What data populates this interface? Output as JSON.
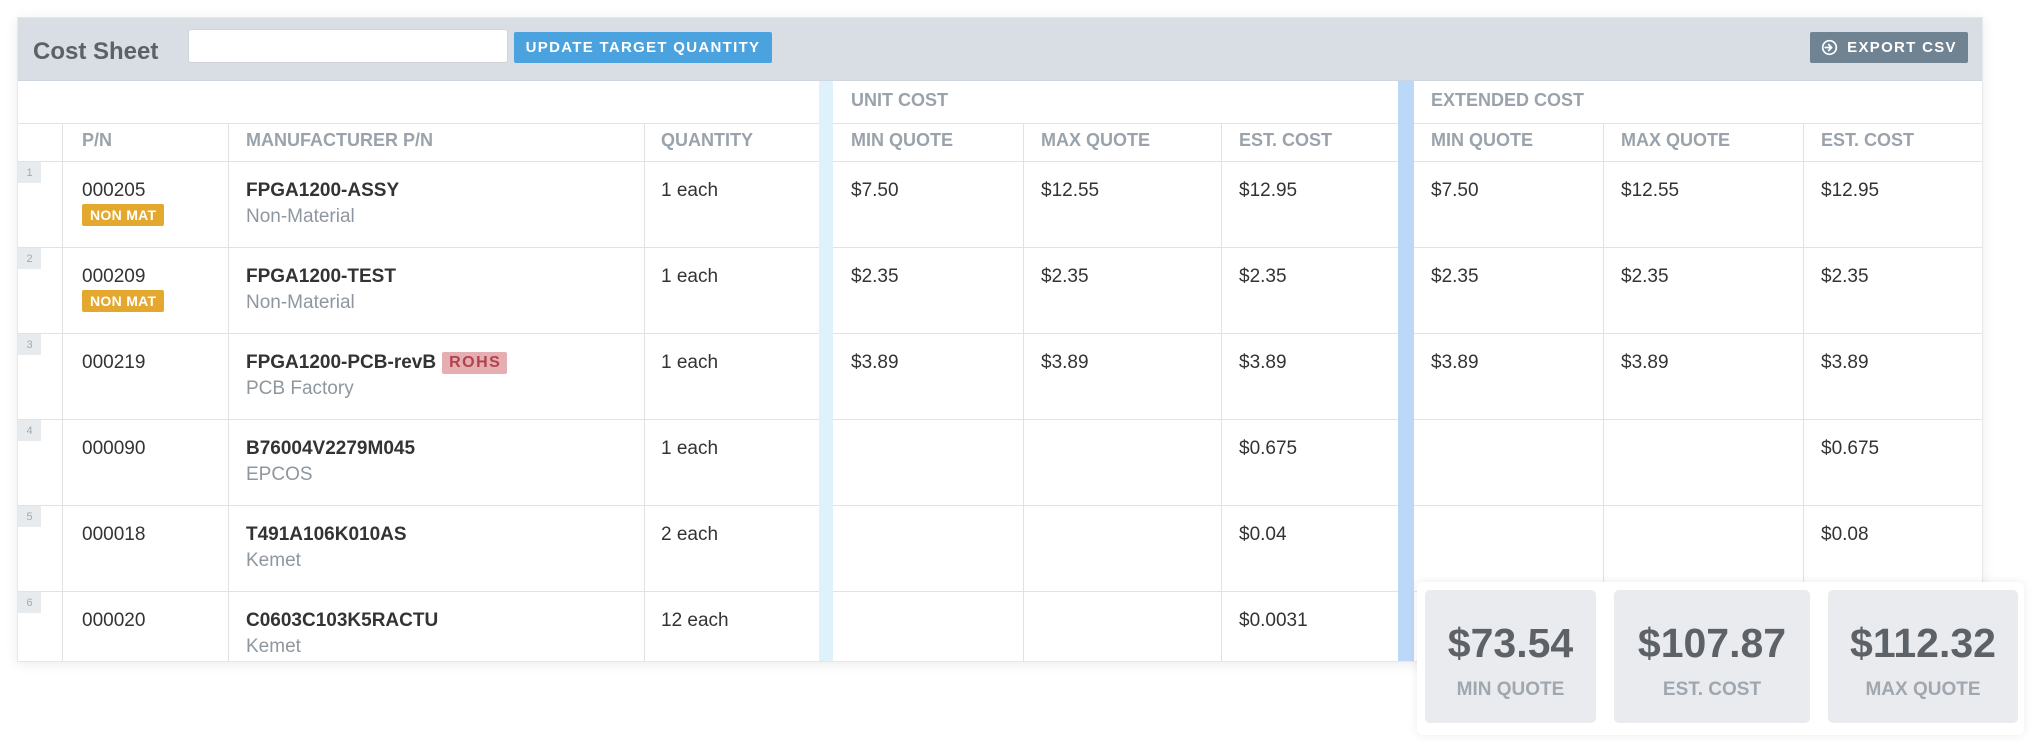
{
  "toolbar": {
    "title": "Cost Sheet",
    "quantity_input_value": "",
    "quantity_input_placeholder": "",
    "update_button_label": "UPDATE TARGET QUANTITY",
    "export_button_label": "EXPORT CSV",
    "update_button_color": "#4aa3df",
    "export_button_color": "#6f8392"
  },
  "groups": {
    "unit_cost": "UNIT COST",
    "extended_cost": "EXTENDED COST"
  },
  "columns": {
    "pn": "P/N",
    "manufacturer_pn": "MANUFACTURER P/N",
    "quantity": "QUANTITY",
    "unit_min": "MIN QUOTE",
    "unit_max": "MAX QUOTE",
    "unit_est": "EST. COST",
    "ext_min": "MIN QUOTE",
    "ext_max": "MAX QUOTE",
    "ext_est": "EST. COST"
  },
  "rows": [
    {
      "num": "1",
      "pn": "000205",
      "badge": "NON MAT",
      "mpn": "FPGA1200-ASSY",
      "rohs": "",
      "mfr": "Non-Material",
      "qty": "1 each",
      "unit_min": "$7.50",
      "unit_max": "$12.55",
      "unit_est": "$12.95",
      "ext_min": "$7.50",
      "ext_max": "$12.55",
      "ext_est": "$12.95"
    },
    {
      "num": "2",
      "pn": "000209",
      "badge": "NON MAT",
      "mpn": "FPGA1200-TEST",
      "rohs": "",
      "mfr": "Non-Material",
      "qty": "1 each",
      "unit_min": "$2.35",
      "unit_max": "$2.35",
      "unit_est": "$2.35",
      "ext_min": "$2.35",
      "ext_max": "$2.35",
      "ext_est": "$2.35"
    },
    {
      "num": "3",
      "pn": "000219",
      "badge": "",
      "mpn": "FPGA1200-PCB-revB",
      "rohs": "ROHS",
      "mfr": "PCB Factory",
      "qty": "1 each",
      "unit_min": "$3.89",
      "unit_max": "$3.89",
      "unit_est": "$3.89",
      "ext_min": "$3.89",
      "ext_max": "$3.89",
      "ext_est": "$3.89"
    },
    {
      "num": "4",
      "pn": "000090",
      "badge": "",
      "mpn": "B76004V2279M045",
      "rohs": "",
      "mfr": "EPCOS",
      "qty": "1 each",
      "unit_min": "",
      "unit_max": "",
      "unit_est": "$0.675",
      "ext_min": "",
      "ext_max": "",
      "ext_est": "$0.675"
    },
    {
      "num": "5",
      "pn": "000018",
      "badge": "",
      "mpn": "T491A106K010AS",
      "rohs": "",
      "mfr": "Kemet",
      "qty": "2 each",
      "unit_min": "",
      "unit_max": "",
      "unit_est": "$0.04",
      "ext_min": "",
      "ext_max": "",
      "ext_est": "$0.08"
    },
    {
      "num": "6",
      "pn": "000020",
      "badge": "",
      "mpn": "C0603C103K5RACTU",
      "rohs": "",
      "mfr": "Kemet",
      "qty": "12 each",
      "unit_min": "",
      "unit_max": "",
      "unit_est": "$0.0031",
      "ext_min": "",
      "ext_max": "",
      "ext_est": ""
    }
  ],
  "summary": {
    "min_quote_value": "$73.54",
    "min_quote_label": "MIN QUOTE",
    "est_cost_value": "$107.87",
    "est_cost_label": "EST. COST",
    "max_quote_value": "$112.32",
    "max_quote_label": "MAX QUOTE"
  },
  "colors": {
    "toolbar_bg": "#d8dee4",
    "non_mat_badge": "#e5a82f",
    "rohs_badge_bg": "#e5aeb2",
    "rohs_badge_text": "#b1424c",
    "unit_cost_separator": "#dff2fc",
    "extended_cost_separator": "#bcd8f8"
  }
}
